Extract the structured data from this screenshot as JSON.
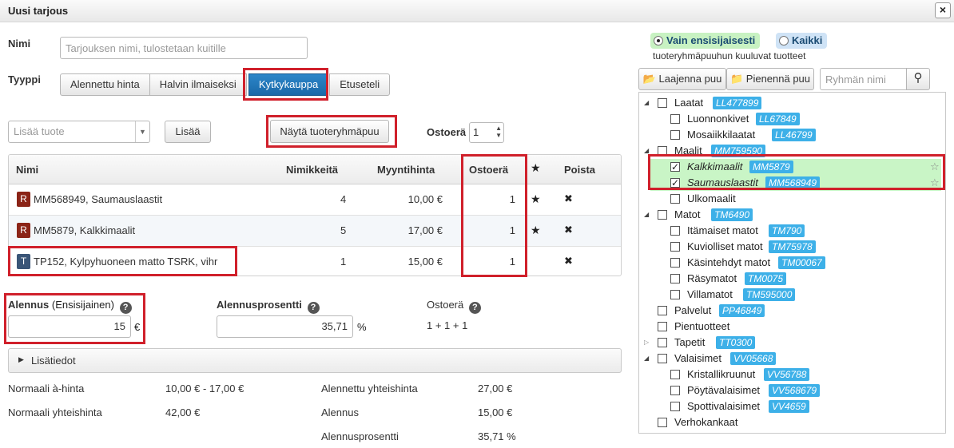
{
  "window": {
    "title": "Uusi tarjous",
    "close_label": "×"
  },
  "form": {
    "name_label": "Nimi",
    "name_placeholder": "Tarjouksen nimi, tulostetaan kuitille",
    "type_label": "Tyyppi",
    "type_options": [
      "Alennettu hinta",
      "Halvin ilmaiseksi",
      "Kytkykauppa",
      "Etuseteli"
    ],
    "type_selected": "Kytkykauppa",
    "add_product_placeholder": "Lisää tuote",
    "add_button": "Lisää",
    "show_tree_button": "Näytä tuoteryhmäpuu",
    "purchase_qty_label": "Ostoerä",
    "purchase_qty_value": "1"
  },
  "table": {
    "headers": {
      "name": "Nimi",
      "titles": "Nimikkeitä",
      "price": "Myyntihinta",
      "qty": "Ostoerä",
      "remove": "Poista"
    },
    "rows": [
      {
        "badge": "R",
        "name": "MM568949, Saumauslaastit",
        "titles": "4",
        "price": "10,00 €",
        "qty": "1",
        "starred": true
      },
      {
        "badge": "R",
        "name": "MM5879, Kalkkimaalit",
        "titles": "5",
        "price": "17,00 €",
        "qty": "1",
        "starred": true
      },
      {
        "badge": "T",
        "name": "TP152, Kylpyhuoneen matto TSRK, vihr",
        "titles": "1",
        "price": "15,00 €",
        "qty": "1",
        "starred": false
      }
    ]
  },
  "discount": {
    "label": "Alennus",
    "label_suffix": "(Ensisijainen)",
    "value": "15",
    "currency": "€",
    "percent_label": "Alennusprosentti",
    "percent_value": "35,71",
    "percent_unit": "%",
    "qty_label": "Ostoerä",
    "qty_value": "1 + 1 + 1"
  },
  "more_info": {
    "label": "Lisätiedot"
  },
  "summary": {
    "normal_unit_label": "Normaali à-hinta",
    "normal_unit_value": "10,00 € - 17,00 €",
    "normal_total_label": "Normaali yhteishinta",
    "normal_total_value": "42,00 €",
    "discounted_total_label": "Alennettu yhteishinta",
    "discounted_total_value": "27,00 €",
    "discount_label": "Alennus",
    "discount_value": "15,00 €",
    "discount_percent_label": "Alennusprosentti",
    "discount_percent_value": "35,71 %"
  },
  "tree_panel": {
    "radio_primary": "Vain ensisijaisesti",
    "radio_all": "Kaikki",
    "caption": "tuoteryhmäpuuhun kuuluvat tuotteet",
    "expand_button": "Laajenna puu",
    "collapse_button": "Pienennä puu",
    "search_placeholder": "Ryhmän nimi",
    "nodes": [
      {
        "label": "Laatat",
        "tag": "LL477899"
      },
      {
        "label": "Luonnonkivet",
        "tag": "LL67849"
      },
      {
        "label": "Mosaiikkilaatat",
        "tag": "LL46799"
      },
      {
        "label": "Maalit",
        "tag": "MM759590"
      },
      {
        "label": "Kalkkimaalit",
        "tag": "MM5879"
      },
      {
        "label": "Saumauslaastit",
        "tag": "MM568949"
      },
      {
        "label": "Ulkomaalit",
        "tag": ""
      },
      {
        "label": "Matot",
        "tag": "TM6490"
      },
      {
        "label": "Itämaiset matot",
        "tag": "TM790"
      },
      {
        "label": "Kuviolliset matot",
        "tag": "TM75978"
      },
      {
        "label": "Käsintehdyt matot",
        "tag": "TM00067"
      },
      {
        "label": "Räsymatot",
        "tag": "TM0075"
      },
      {
        "label": "Villamatot",
        "tag": "TM595000"
      },
      {
        "label": "Palvelut",
        "tag": "PP46849"
      },
      {
        "label": "Pientuotteet",
        "tag": ""
      },
      {
        "label": "Tapetit",
        "tag": "TT0300"
      },
      {
        "label": "Valaisimet",
        "tag": "VV05668"
      },
      {
        "label": "Kristallikruunut",
        "tag": "VV56788"
      },
      {
        "label": "Pöytävalaisimet",
        "tag": "VV568679"
      },
      {
        "label": "Spottivalaisimet",
        "tag": "VV4659"
      },
      {
        "label": "Verhokankaat",
        "tag": ""
      }
    ]
  }
}
